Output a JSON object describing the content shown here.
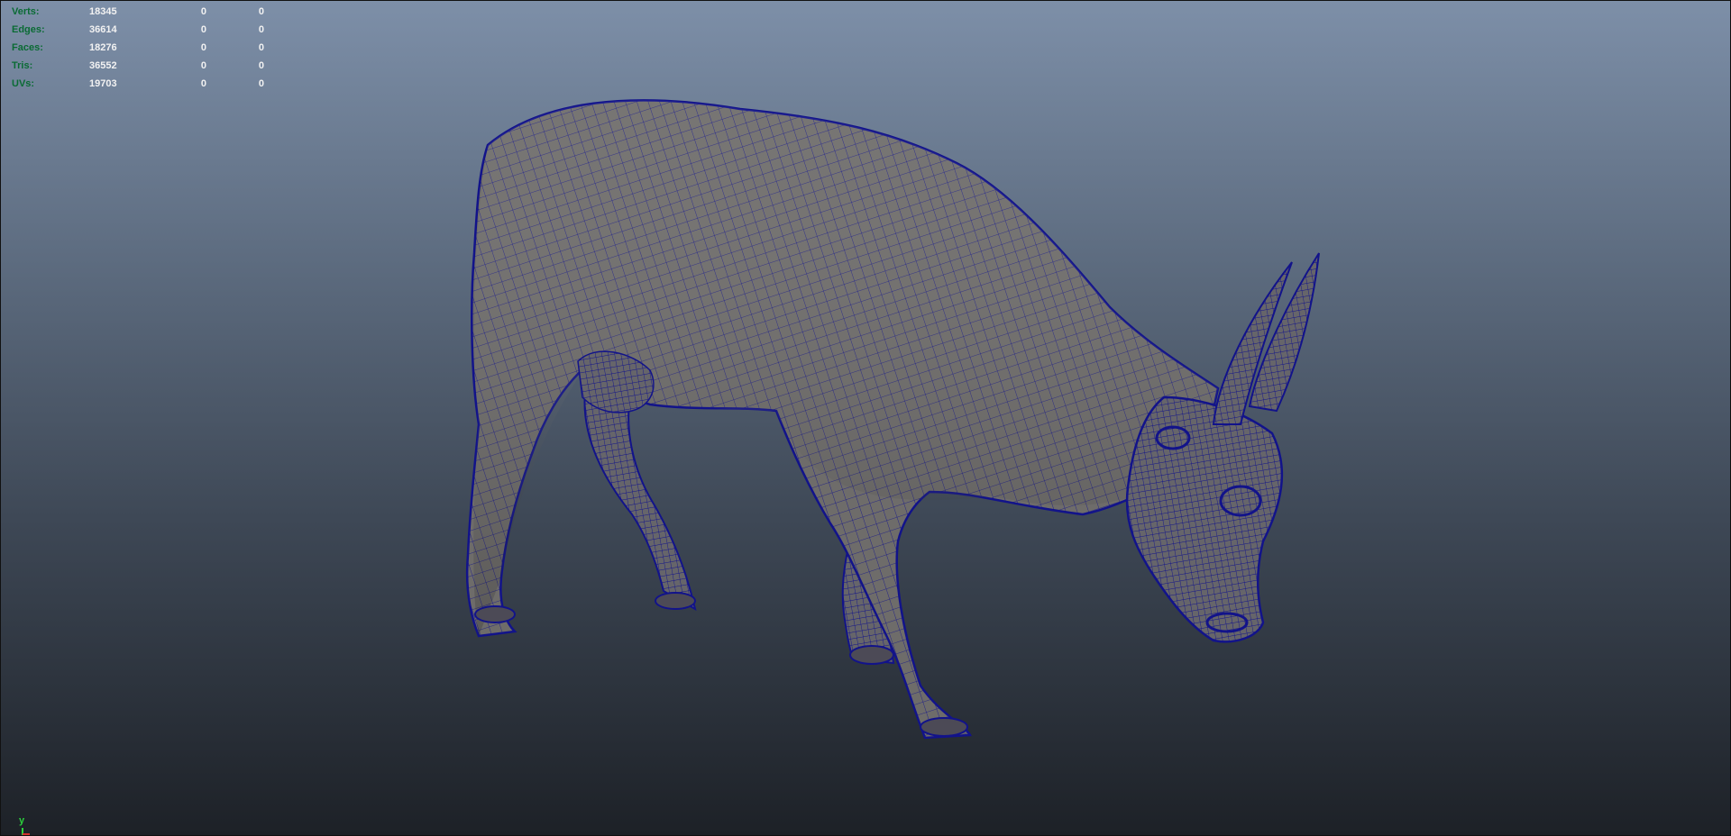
{
  "hud": {
    "rows": [
      {
        "label": "Verts:",
        "total": "18345",
        "selected": "0",
        "selected2": "0"
      },
      {
        "label": "Edges:",
        "total": "36614",
        "selected": "0",
        "selected2": "0"
      },
      {
        "label": "Faces:",
        "total": "18276",
        "selected": "0",
        "selected2": "0"
      },
      {
        "label": "Tris:",
        "total": "36552",
        "selected": "0",
        "selected2": "0"
      },
      {
        "label": "UVs:",
        "total": "19703",
        "selected": "0",
        "selected2": "0"
      }
    ]
  },
  "axis": {
    "y_label": "y"
  },
  "colors": {
    "label": "#0a6b34",
    "value": "#f2f2f2",
    "mesh_fill": "#6e6c6a",
    "wire": "#12138a",
    "axis_y": "#2bd13c",
    "axis_x": "#d2322d"
  },
  "model": {
    "icon": "cow-wireframe-mesh"
  }
}
